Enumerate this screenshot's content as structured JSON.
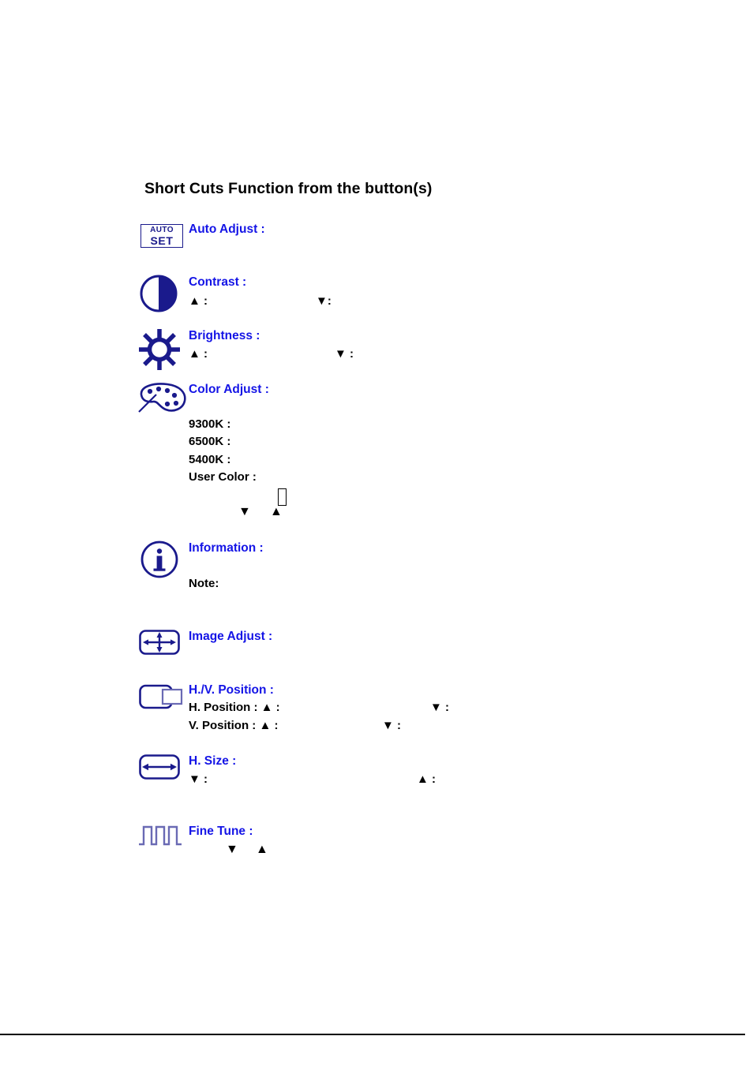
{
  "page": {
    "section_title": "Short Cuts Function from the button(s)",
    "accent_label_color": "#1414e6",
    "icon_color": "#1a1a8c",
    "text_color": "#000000",
    "background": "#ffffff"
  },
  "autoset_button": {
    "line1": "AUTO",
    "line2": "SET"
  },
  "items": [
    {
      "icon": "auto-set-button-icon",
      "label": "Auto Adjust :"
    },
    {
      "icon": "contrast-icon",
      "label": "Contrast :",
      "up_arrow": "▲ :",
      "down_arrow": "▼:"
    },
    {
      "icon": "brightness-sun-icon",
      "label": "Brightness :",
      "up_arrow": "▲ :",
      "down_arrow": "▼ :"
    },
    {
      "icon": "color-palette-icon",
      "label": "Color Adjust :",
      "options": [
        "9300K :",
        "6500K :",
        "5400K :",
        "User Color :"
      ],
      "down_arrow": "▼",
      "up_arrow": "▲",
      "missing_glyph": ""
    },
    {
      "icon": "information-icon",
      "label": "Information :",
      "note": "Note:"
    },
    {
      "icon": "image-adjust-icon",
      "label": "Image Adjust :"
    },
    {
      "icon": "hv-position-icon",
      "label": "H./V. Position :",
      "h_position": "H. Position : ▲ :",
      "h_position_down": "▼ :",
      "v_position": "V. Position : ▲ :",
      "v_position_down": "▼ :"
    },
    {
      "icon": "h-size-icon",
      "label": "H. Size :",
      "down_arrow": "▼ :",
      "up_arrow": "▲ :"
    },
    {
      "icon": "fine-tune-icon",
      "label": "Fine Tune :",
      "down_arrow": "▼",
      "up_arrow": "▲"
    }
  ]
}
